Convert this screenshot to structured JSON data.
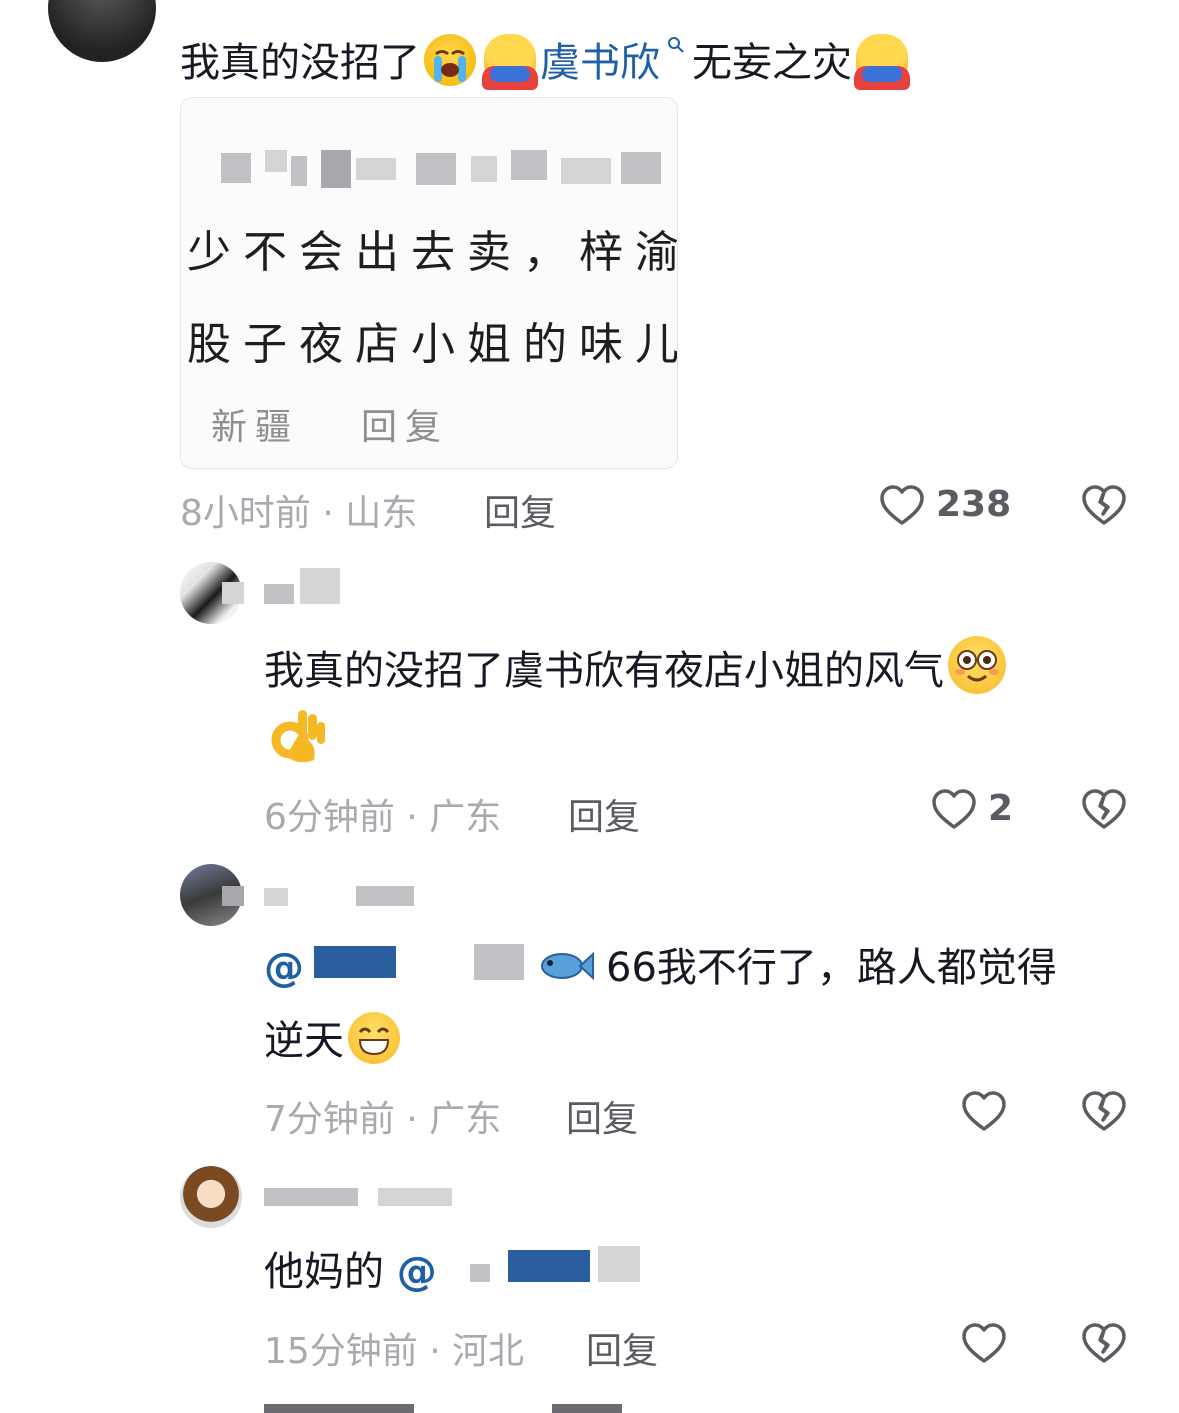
{
  "comments": [
    {
      "text_prefix": "我真的没招了",
      "mention": "虞书欣",
      "text_suffix": "无妄之灾",
      "image": {
        "line1": "少不会出去卖，梓渝",
        "line2": "股子夜店小姐的味儿",
        "meta_location": "新疆",
        "meta_reply": "回复"
      },
      "time_location": "8小时前 · 山东",
      "reply_label": "回复",
      "likes": "238"
    }
  ],
  "replies": [
    {
      "text_line1": "我真的没招了虞书欣有夜店小姐的风气",
      "time_location": "6分钟前 · 广东",
      "reply_label": "回复",
      "likes": "2"
    },
    {
      "at_symbol": "@",
      "text_line1": "66我不行了，路人都觉得",
      "text_line2": "逆天",
      "time_location": "7分钟前 · 广东",
      "reply_label": "回复",
      "likes": ""
    },
    {
      "text_line1": "他妈的",
      "at_symbol": "@",
      "time_location": "15分钟前 · 河北",
      "reply_label": "回复",
      "likes": ""
    }
  ],
  "icons": {
    "like": "heart-outline-icon",
    "dislike": "broken-heart-icon",
    "search": "search-icon"
  },
  "colors": {
    "link": "#1f5fa5",
    "meta": "#a9aab0",
    "text": "#161823"
  }
}
